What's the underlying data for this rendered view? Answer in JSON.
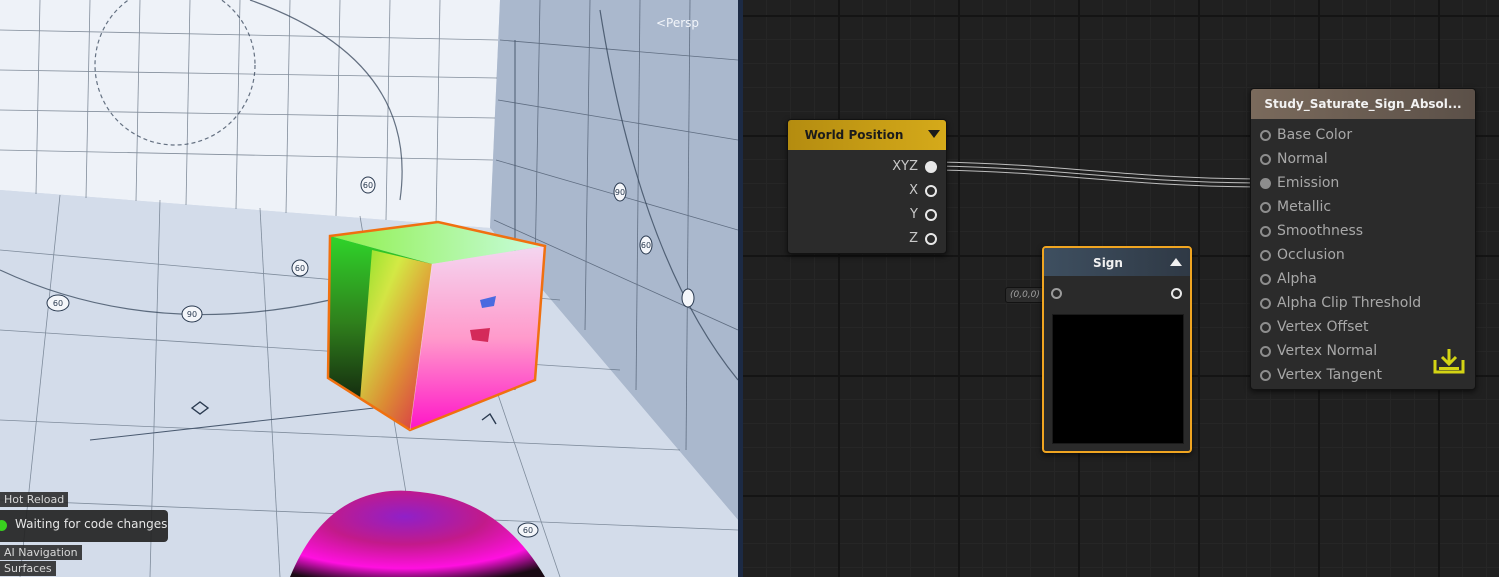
{
  "scene": {
    "camera_label": "<Persp",
    "hot_reload": {
      "title": "Hot Reload",
      "status": "Waiting for code changes",
      "status_color": "#39d11f"
    },
    "ai_navigation": {
      "title": "AI Navigation",
      "item": "Surfaces"
    },
    "gizmo_labels": [
      "60",
      "90",
      "60",
      "60",
      "90",
      "60",
      "60"
    ]
  },
  "graph": {
    "world_position_node": {
      "title": "World Position",
      "ports": [
        "XYZ",
        "X",
        "Y",
        "Z"
      ],
      "header_color": "#c9a014"
    },
    "sign_node": {
      "title": "Sign",
      "default_input": "(0,0,0)",
      "selected_color": "#f0a521"
    },
    "output_node": {
      "title": "Study_Saturate_Sign_Absol...",
      "inputs": [
        "Base Color",
        "Normal",
        "Emission",
        "Metallic",
        "Smoothness",
        "Occlusion",
        "Alpha",
        "Alpha Clip Threshold",
        "Vertex Offset",
        "Vertex Normal",
        "Vertex Tangent"
      ],
      "connected_input": "Emission",
      "save_icon": "download-tray-icon",
      "save_icon_color": "#d4d414"
    }
  }
}
